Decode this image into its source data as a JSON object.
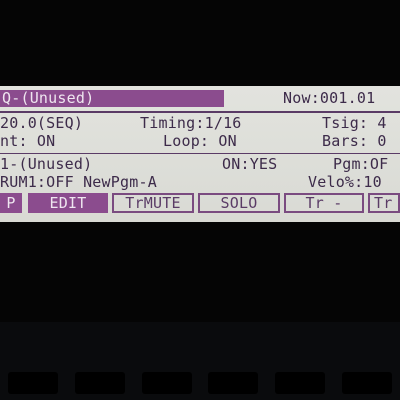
{
  "lcd": {
    "row1": {
      "sequence": "Q-(Unused)",
      "now": "Now:001.01"
    },
    "row2": {
      "tempo": "20.0(SEQ)",
      "timing": "Timing:1/16",
      "tsig": "Tsig: 4"
    },
    "row3": {
      "count": "nt: ON",
      "loop": "Loop: ON",
      "bars": "Bars: 0"
    },
    "row4": {
      "track": "1-(Unused)",
      "on": "ON:YES",
      "pgm": "Pgm:OF"
    },
    "row5": {
      "drum": "RUM1:OFF NewPgm-A",
      "velo": "Velo%:10"
    }
  },
  "softkeys": [
    {
      "label": "P"
    },
    {
      "label": "EDIT"
    },
    {
      "label": "TrMUTE"
    },
    {
      "label": "SOLO"
    },
    {
      "label": "Tr -"
    },
    {
      "label": "Tr"
    }
  ],
  "colors": {
    "lcd_background": "#e0e1dc",
    "lcd_text": "#3d2b4a",
    "inverse_highlight": "#8b4c8e"
  }
}
